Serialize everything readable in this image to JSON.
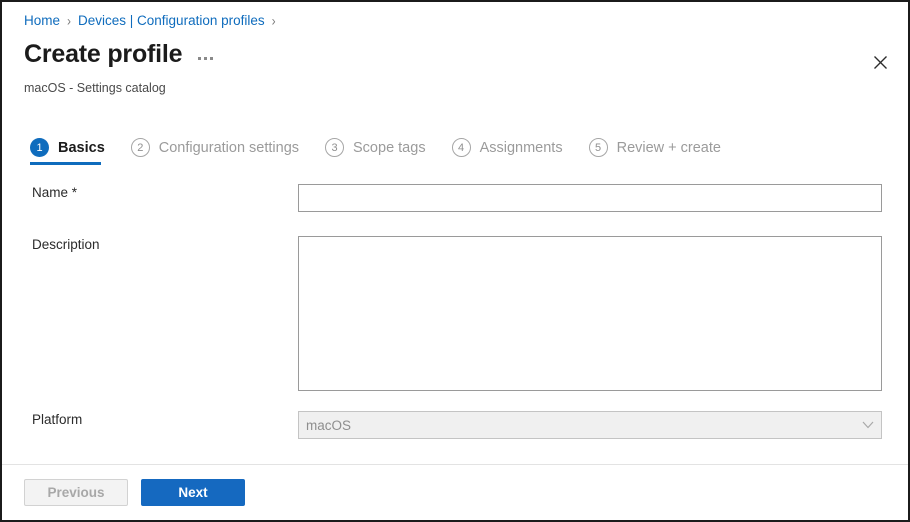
{
  "window": {
    "accent_color": "#0f6cbd",
    "primary_button_color": "#1569c0",
    "link_color": "#0f6cbd"
  },
  "breadcrumb": {
    "items": [
      {
        "label": "Home"
      },
      {
        "label": "Devices | Configuration profiles"
      }
    ],
    "separator": "›",
    "trailing_separator": "›"
  },
  "header": {
    "title": "Create profile",
    "subtitle": "macOS - Settings catalog",
    "more_options_icon": "ellipsis-icon",
    "close_icon": "close-icon"
  },
  "wizard": {
    "steps": [
      {
        "number": "1",
        "label": "Basics",
        "state": "active"
      },
      {
        "number": "2",
        "label": "Configuration settings",
        "state": "inactive"
      },
      {
        "number": "3",
        "label": "Scope tags",
        "state": "inactive"
      },
      {
        "number": "4",
        "label": "Assignments",
        "state": "inactive"
      },
      {
        "number": "5",
        "label": "Review + create",
        "state": "inactive"
      }
    ]
  },
  "form": {
    "name": {
      "label": "Name *",
      "value": "",
      "placeholder": ""
    },
    "description": {
      "label": "Description",
      "value": "",
      "placeholder": ""
    },
    "platform": {
      "label": "Platform",
      "value": "macOS",
      "disabled": true,
      "chevron_icon": "chevron-down-icon"
    }
  },
  "footer": {
    "previous_label": "Previous",
    "next_label": "Next"
  }
}
